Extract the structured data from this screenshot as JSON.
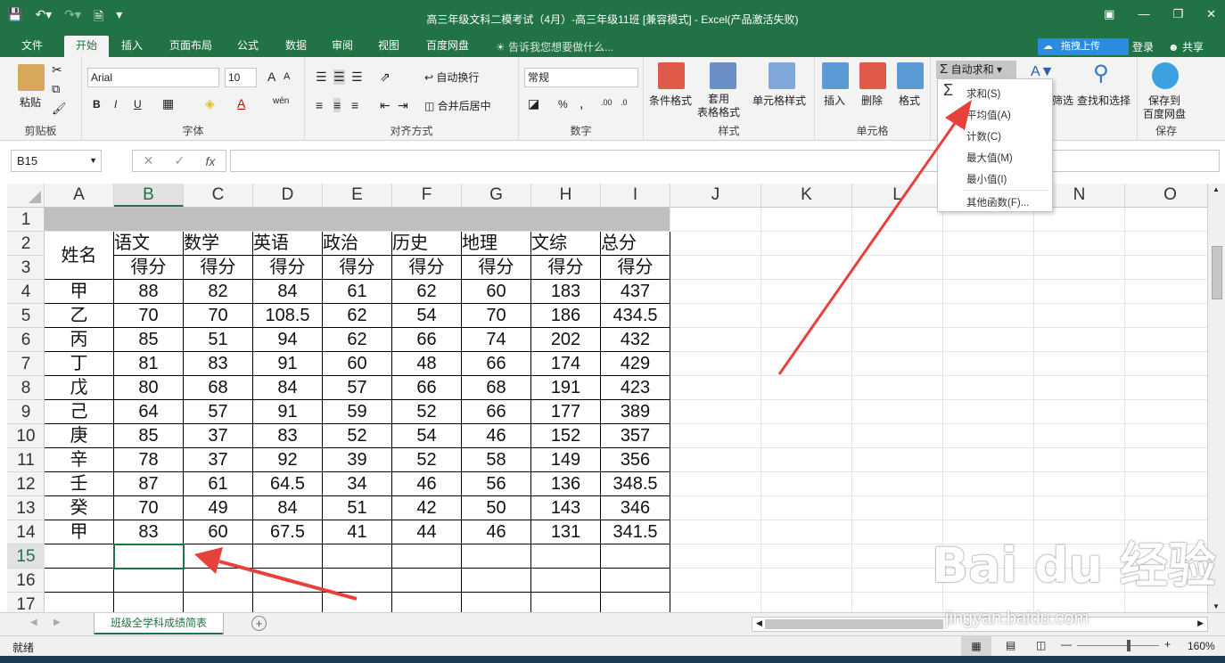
{
  "window": {
    "title": "高三年级文科二模考试（4月）-高三年级11班  [兼容模式] - Excel(产品激活失败)",
    "ribbon_display_icon": "ribbon-display-icon",
    "minimize_icon": "minimize-icon",
    "restore_icon": "restore-icon",
    "close_icon": "close-icon"
  },
  "tabs": [
    "文件",
    "开始",
    "插入",
    "页面布局",
    "公式",
    "数据",
    "审阅",
    "视图",
    "百度网盘"
  ],
  "active_tab": "开始",
  "tell_me": "告诉我您想要做什么...",
  "upload_label": "拖拽上传",
  "login_label": "登录",
  "share_label": "共享",
  "ribbon": {
    "clipboard": {
      "name": "剪贴板",
      "paste": "粘贴"
    },
    "font": {
      "name": "字体",
      "font_name": "Arial",
      "font_size": "10",
      "bold": "B",
      "italic": "I",
      "underline": "U",
      "font_color": "A",
      "pinyin": "wén",
      "grow": "A",
      "shrink": "A"
    },
    "alignment": {
      "name": "对齐方式",
      "wrap": "自动换行",
      "merge": "合并后居中"
    },
    "number": {
      "name": "数字",
      "format": "常规",
      "percent": "%",
      "comma": ","
    },
    "styles": {
      "name": "样式",
      "conditional": "条件格式",
      "table": "套用\n表格格式",
      "cell_styles": "单元格样式"
    },
    "cells": {
      "name": "单元格",
      "insert": "插入",
      "delete": "删除",
      "format": "格式"
    },
    "editing": {
      "autosum": "自动求和",
      "sort_filter": "筛选",
      "find": "查找和选择"
    },
    "save": {
      "name": "保存",
      "label1": "保存到",
      "label2": "百度网盘"
    }
  },
  "autosum_menu": [
    "求和(S)",
    "平均值(A)",
    "计数(C)",
    "最大值(M)",
    "最小值(I)",
    "其他函数(F)..."
  ],
  "name_box": "B15",
  "fx_label": "fx",
  "columns": [
    "A",
    "B",
    "C",
    "D",
    "E",
    "F",
    "G",
    "H",
    "I",
    "J",
    "K",
    "L",
    "M",
    "N",
    "O"
  ],
  "selected_column": "B",
  "rows": [
    "1",
    "2",
    "3",
    "4",
    "5",
    "6",
    "7",
    "8",
    "9",
    "10",
    "11",
    "12",
    "13",
    "14",
    "15",
    "16",
    "17"
  ],
  "selected_row": "15",
  "table": {
    "name_header": "姓名",
    "subjects": [
      "语文",
      "数学",
      "英语",
      "政治",
      "历史",
      "地理",
      "文综",
      "总分"
    ],
    "score_label": "得分",
    "data": [
      [
        "甲",
        "88",
        "82",
        "84",
        "61",
        "62",
        "60",
        "183",
        "437"
      ],
      [
        "乙",
        "70",
        "70",
        "108.5",
        "62",
        "54",
        "70",
        "186",
        "434.5"
      ],
      [
        "丙",
        "85",
        "51",
        "94",
        "62",
        "66",
        "74",
        "202",
        "432"
      ],
      [
        "丁",
        "81",
        "83",
        "91",
        "60",
        "48",
        "66",
        "174",
        "429"
      ],
      [
        "戊",
        "80",
        "68",
        "84",
        "57",
        "66",
        "68",
        "191",
        "423"
      ],
      [
        "己",
        "64",
        "57",
        "91",
        "59",
        "52",
        "66",
        "177",
        "389"
      ],
      [
        "庚",
        "85",
        "37",
        "83",
        "52",
        "54",
        "46",
        "152",
        "357"
      ],
      [
        "辛",
        "78",
        "37",
        "92",
        "39",
        "52",
        "58",
        "149",
        "356"
      ],
      [
        "壬",
        "87",
        "61",
        "64.5",
        "34",
        "46",
        "56",
        "136",
        "348.5"
      ],
      [
        "癸",
        "70",
        "49",
        "84",
        "51",
        "42",
        "50",
        "143",
        "346"
      ],
      [
        "甲",
        "83",
        "60",
        "67.5",
        "41",
        "44",
        "46",
        "131",
        "341.5"
      ]
    ]
  },
  "sheet_tab": "班级全学科成绩简表",
  "status": "就绪",
  "zoom": "160%",
  "watermark": "Bai du 经验",
  "watermark_url": "jingyan.baidu.com",
  "colors": {
    "excel_green": "#217346",
    "arrow_red": "#e8403a"
  }
}
